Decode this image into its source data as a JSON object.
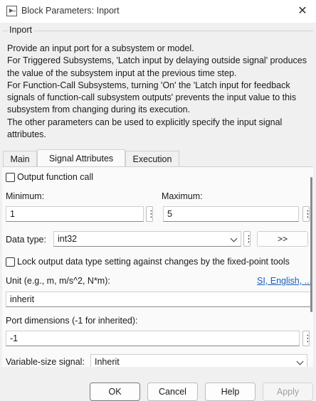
{
  "window": {
    "title": "Block Parameters: Inport",
    "close_glyph": "✕",
    "icon": "simulink-block-icon"
  },
  "group": {
    "title": "Inport"
  },
  "description": "Provide an input port for a subsystem or model.\nFor Triggered Subsystems, 'Latch input by delaying outside signal' produces the value of the subsystem input at the previous time step.\nFor Function-Call Subsystems, turning 'On' the 'Latch input for feedback signals of function-call subsystem outputs' prevents the input value to this subsystem from changing during its execution.\nThe other parameters can be used to explicitly specify the input signal attributes.",
  "tabs": [
    {
      "label": "Main",
      "active": false
    },
    {
      "label": "Signal Attributes",
      "active": true
    },
    {
      "label": "Execution",
      "active": false
    }
  ],
  "signal_attributes": {
    "output_function_call": {
      "label": "Output function call",
      "checked": false
    },
    "minimum": {
      "label": "Minimum:",
      "value": "1"
    },
    "maximum": {
      "label": "Maximum:",
      "value": "5"
    },
    "data_type": {
      "label": "Data type:",
      "value": "int32",
      "assistant_label": ">>"
    },
    "lock_output": {
      "label": "Lock output data type setting against changes by the fixed-point tools",
      "checked": false
    },
    "unit": {
      "label": "Unit (e.g., m, m/s^2, N*m):",
      "link": "SI, English, ...",
      "value": "inherit"
    },
    "port_dimensions": {
      "label": "Port dimensions (-1 for inherited):",
      "value": "-1"
    },
    "variable_size": {
      "label": "Variable-size signal:",
      "value": "Inherit"
    }
  },
  "buttons": {
    "ok": "OK",
    "cancel": "Cancel",
    "help": "Help",
    "apply": "Apply"
  }
}
